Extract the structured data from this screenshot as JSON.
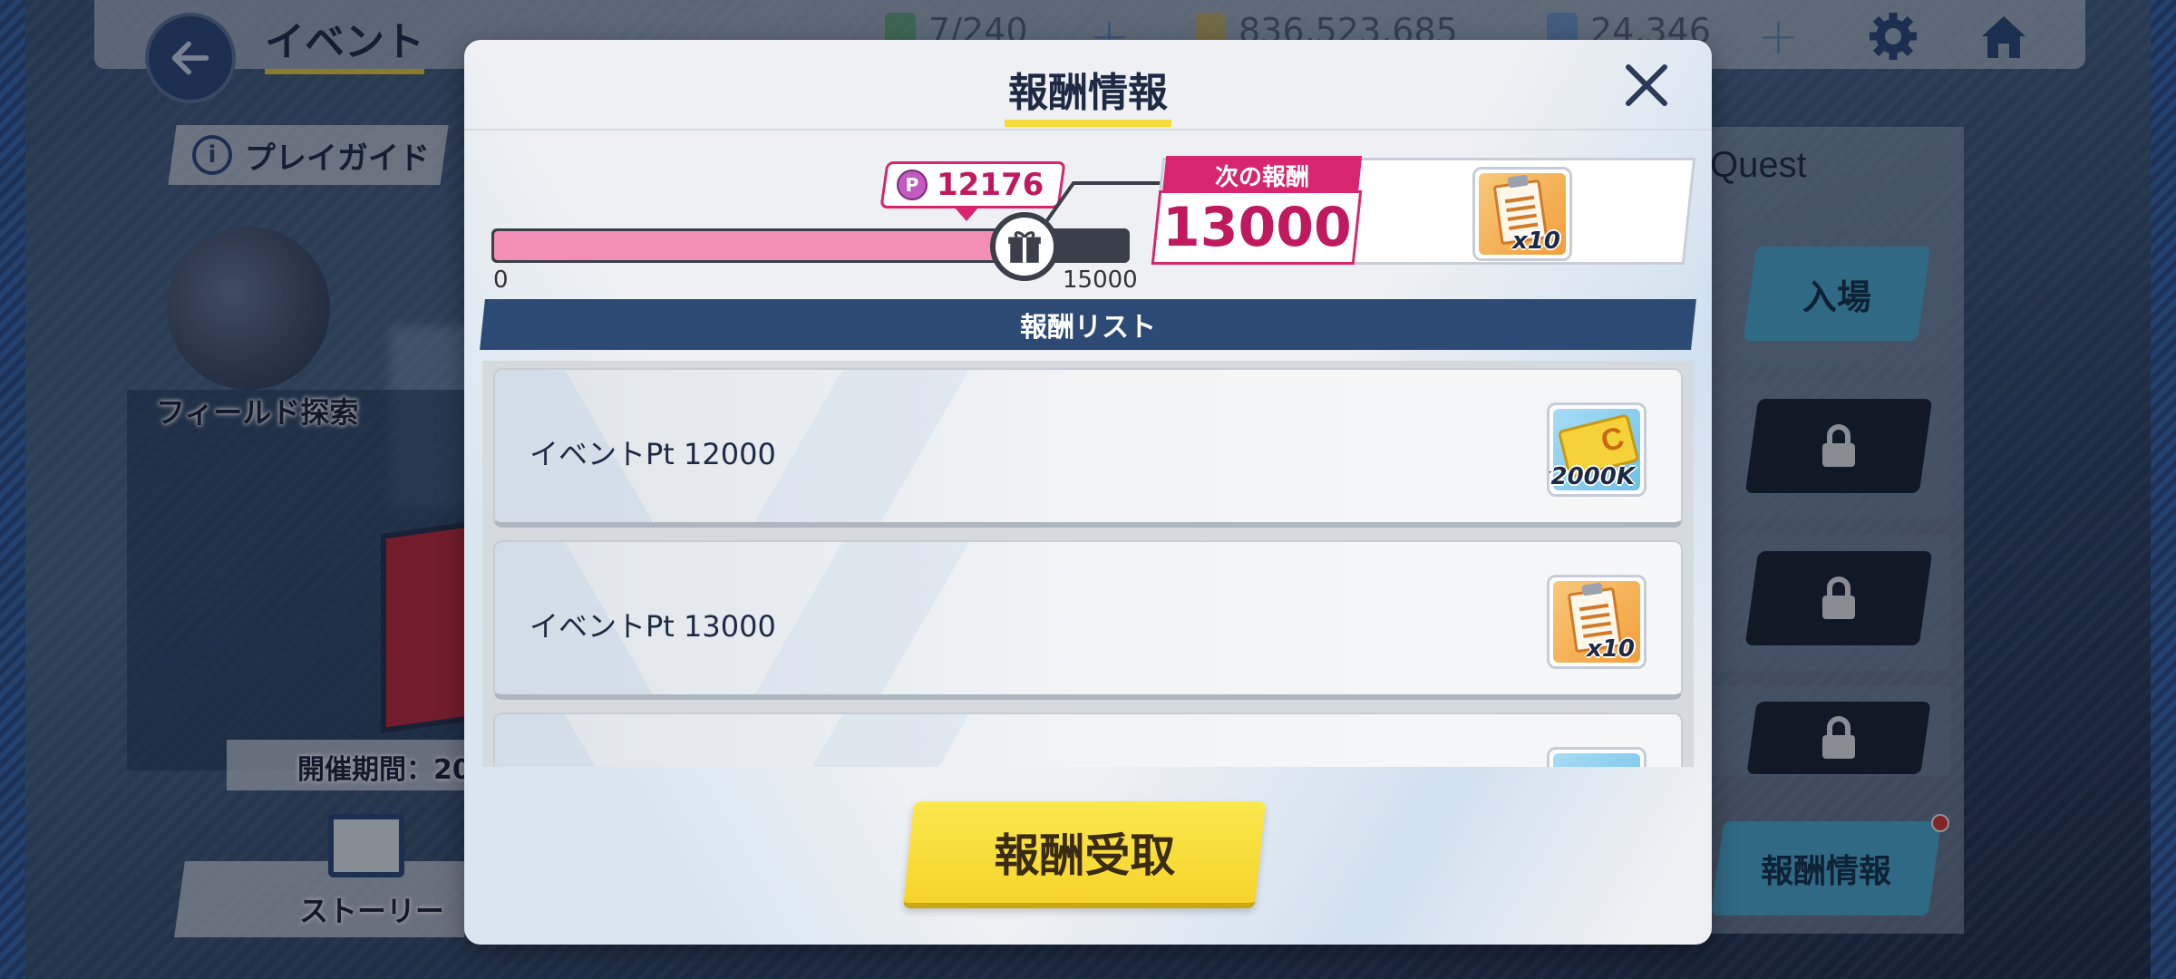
{
  "header": {
    "screen_title": "イベント",
    "stamina": "7/240",
    "coins": "836,523,685",
    "gems": "24,346"
  },
  "left_menu": {
    "guide_label": "プレイガイド",
    "field_label": "フィールド探索",
    "period_label": "開催期間：20",
    "story_label": "ストーリー"
  },
  "right_menu": {
    "quest_title": "Quest",
    "enter_label": "入場",
    "reward_info_label": "報酬情報"
  },
  "modal": {
    "title": "報酬情報",
    "current_points": "12176",
    "progress": {
      "current": 12176,
      "max": 15000,
      "min_label": "0",
      "max_label": "15000"
    },
    "next_reward_label": "次の報酬",
    "next_reward_value": "13000",
    "next_reward_item_qty": "x10",
    "list_header": "報酬リスト",
    "rewards": [
      {
        "label": "イベントPt 12000",
        "item": "credit-card",
        "qty": "x2000K"
      },
      {
        "label": "イベントPt 13000",
        "item": "report-document",
        "qty": "x10"
      }
    ],
    "claim_button": "報酬受取"
  },
  "colors": {
    "accent_pink": "#d8266e",
    "progress_fill": "#f38fb4",
    "list_header_bg": "#2c4a74",
    "claim_yellow": "#f5d42a"
  }
}
